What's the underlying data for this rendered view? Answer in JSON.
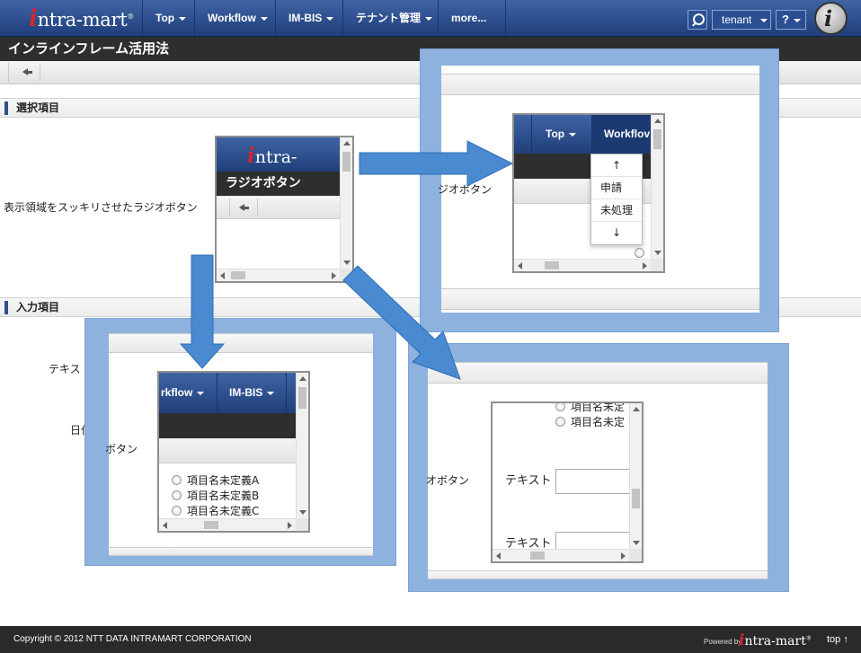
{
  "nav": {
    "logo_mark": "i",
    "logo_text": "ntra-mart",
    "logo_reg": "®",
    "items": [
      {
        "label": "Top"
      },
      {
        "label": "Workflow"
      },
      {
        "label": "IM-BIS"
      },
      {
        "label": "テナント管理"
      },
      {
        "label": "more..."
      }
    ],
    "tenant_label": "tenant",
    "help_label": "?",
    "avatar_mark": "i"
  },
  "page": {
    "title": "インラインフレーム活用法",
    "section1": "選択項目",
    "section2": "入力項目",
    "radio_desc": "表示領域をスッキリさせたラジオボタン",
    "text_label_partial": "テキス",
    "date_label_partial": "日付"
  },
  "mini_center": {
    "logo_mark": "i",
    "logo_text": "ntra-mart",
    "logo_reg": "®",
    "title": "ラジオボタン"
  },
  "callout_top": {
    "partial_label": "ジオボタン",
    "nav_top": "Top",
    "nav_workflow": "Workflov",
    "menu_items": [
      "↑",
      "申請",
      "未処理",
      "↓"
    ]
  },
  "callout_left": {
    "partial_label": "ボタン",
    "nav_workflow": "rkflow",
    "nav_imbis": "IM-BIS",
    "radios": [
      "項目名未定義A",
      "項目名未定義B",
      "項目名未定義C"
    ]
  },
  "callout_right": {
    "partial_label": "オボタン",
    "radios": [
      "項目名未定",
      "項目名未定"
    ],
    "text_labels": [
      "テキスト",
      "テキスト"
    ]
  },
  "footer": {
    "copyright": "Copyright © 2012 NTT DATA INTRAMART CORPORATION",
    "powered_by": "Powered by",
    "logo_mark": "i",
    "logo_text": "ntra-mart",
    "logo_reg": "®",
    "top_link": "top ↑"
  },
  "colors": {
    "nav_blue": "#2c4f8e",
    "title_dark": "#2e2e2e",
    "callout_blue": "#8eb2de",
    "arrow_blue": "#4a8ad0",
    "logo_red": "#d3262d"
  }
}
